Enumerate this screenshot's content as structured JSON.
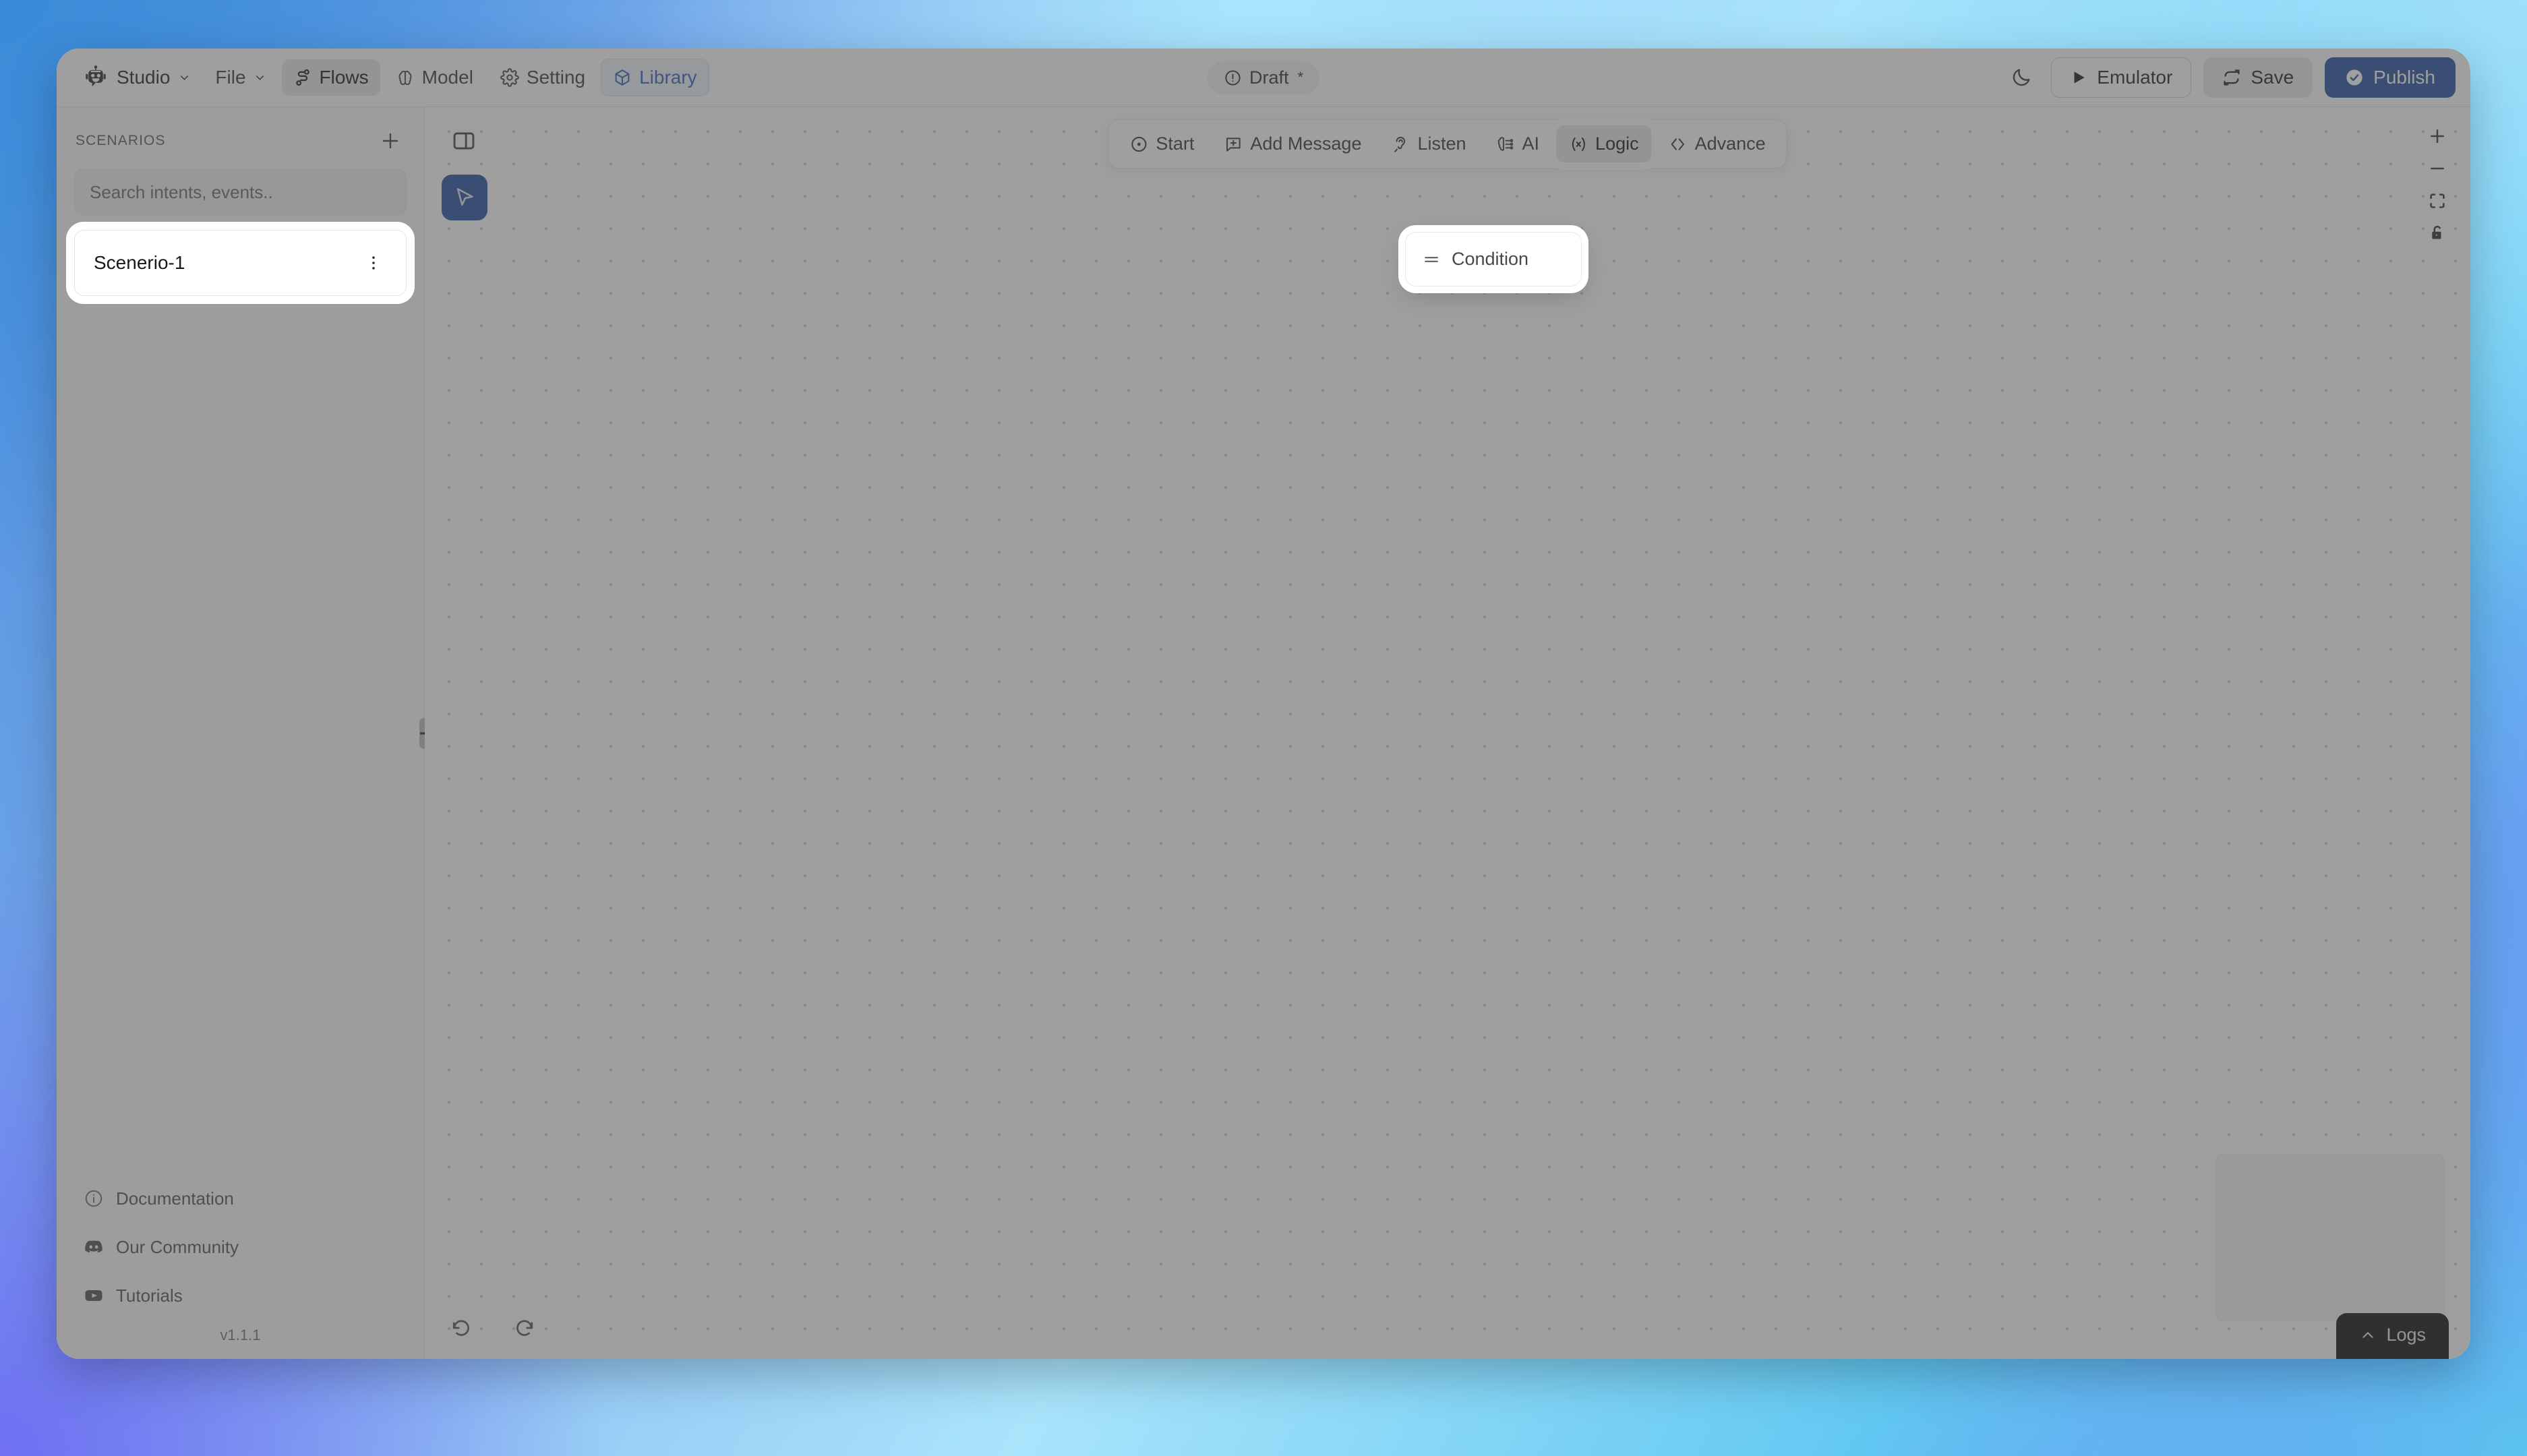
{
  "app": {
    "window_title": "Studio",
    "version": "v1.1.1"
  },
  "header": {
    "brand_label": "Studio",
    "brand_icon": "robot-icon",
    "brand_chevron_icon": "chevron-down-icon",
    "menus": [
      {
        "label": "File",
        "icon": "chevron-down-icon",
        "active": false
      },
      {
        "label": "Flows",
        "icon": "flows-icon",
        "active": true
      },
      {
        "label": "Model",
        "icon": "brain-icon",
        "active": false
      },
      {
        "label": "Setting",
        "icon": "gear-icon",
        "active": false
      },
      {
        "label": "Library",
        "icon": "cube-icon",
        "active": false
      }
    ],
    "status": {
      "label": "Draft",
      "modified_marker": "*",
      "icon": "alert-circle-icon"
    },
    "actions": {
      "theme_toggle_icon": "moon-icon",
      "emulator_label": "Emulator",
      "emulator_icon": "play-icon",
      "save_label": "Save",
      "save_icon": "sync-icon",
      "publish_label": "Publish",
      "publish_icon": "check-circle-icon"
    },
    "colors": {
      "publish_bg": "#1f4b9e",
      "library_text": "#2d5bb9",
      "active_tab_bg": "#e6e6e8"
    }
  },
  "sidebar": {
    "title": "SCENARIOS",
    "add_icon": "plus-icon",
    "search": {
      "placeholder": "Search intents, events..",
      "value": ""
    },
    "scenarios": [
      {
        "name": "Scenerio-1",
        "menu_icon": "kebab-menu-icon",
        "selected": true
      }
    ],
    "footer_links": [
      {
        "label": "Documentation",
        "icon": "info-circle-icon"
      },
      {
        "label": "Our Community",
        "icon": "discord-icon"
      },
      {
        "label": "Tutorials",
        "icon": "youtube-icon"
      }
    ],
    "version": "v1.1.1"
  },
  "canvas": {
    "node_toolbar": [
      {
        "label": "Start",
        "icon": "target-icon",
        "active": false
      },
      {
        "label": "Add Message",
        "icon": "message-plus-icon",
        "active": false
      },
      {
        "label": "Listen",
        "icon": "ear-icon",
        "active": false
      },
      {
        "label": "AI",
        "icon": "ai-chip-icon",
        "active": false
      },
      {
        "label": "Logic",
        "icon": "function-icon",
        "active": true
      },
      {
        "label": "Advance",
        "icon": "code-brackets-icon",
        "active": false
      }
    ],
    "dropdown": {
      "open": true,
      "anchor": "Logic",
      "items": [
        {
          "label": "Condition",
          "icon": "condition-lines-icon"
        }
      ]
    },
    "tools": {
      "panel_toggle_icon": "panel-toggle-icon",
      "cursor_tool_icon": "cursor-pointer-icon",
      "cursor_tool_active": true,
      "zoom_in_icon": "plus-icon",
      "zoom_out_icon": "minus-icon",
      "fit_view_icon": "fit-view-icon",
      "lock_icon": "lock-icon",
      "undo_icon": "undo-icon",
      "redo_icon": "redo-icon"
    },
    "minimap": {
      "visible": true
    },
    "logs": {
      "label": "Logs",
      "icon": "chevron-up-icon"
    }
  }
}
